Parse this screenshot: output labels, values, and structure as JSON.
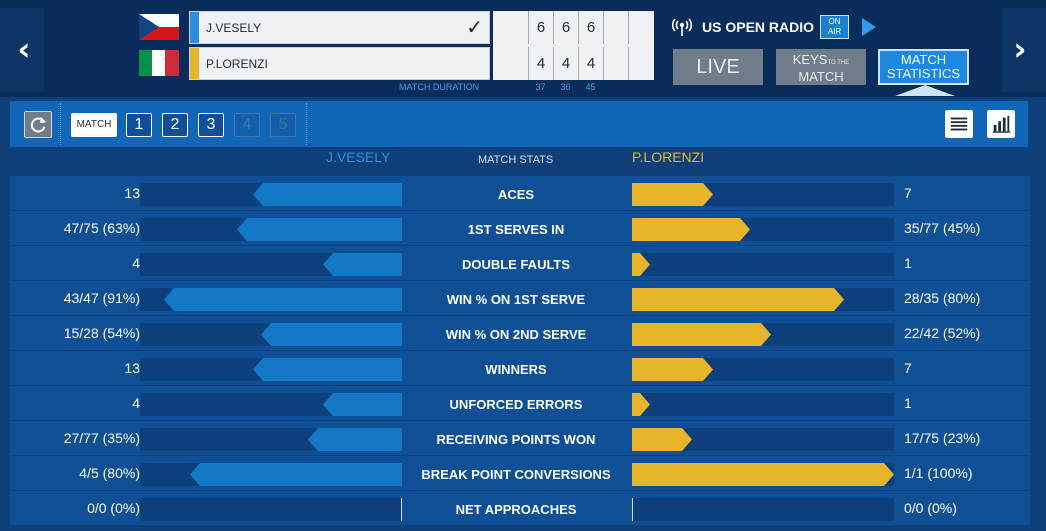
{
  "nav": {
    "prev_icon": "chevron-left-icon",
    "next_icon": "chevron-right-icon",
    "prev_glyph": "‹",
    "next_glyph": "›"
  },
  "match": {
    "player1": {
      "name": "J.VESELY",
      "country": "Czech Republic",
      "sets": [
        "6",
        "6",
        "6",
        "",
        ""
      ],
      "winner_mark": "✓",
      "color": "#2f8ddc"
    },
    "player2": {
      "name": "P.LORENZI",
      "country": "Italy",
      "sets": [
        "4",
        "4",
        "4",
        "",
        ""
      ],
      "color": "#e7b52a"
    },
    "duration_label": "MATCH DURATION",
    "set_durations": [
      "37",
      "36",
      "45"
    ]
  },
  "radio": {
    "label": "US OPEN RADIO",
    "on_air_line1": "ON",
    "on_air_line2": "AIR"
  },
  "tabs": {
    "live": "LIVE",
    "keys_line1": "KEYS",
    "keys_small": "TO THE",
    "keys_line2": "MATCH",
    "stats_line1": "MATCH",
    "stats_line2": "STATISTICS"
  },
  "toolbar": {
    "match_label": "MATCH",
    "sets": [
      {
        "label": "1",
        "enabled": true
      },
      {
        "label": "2",
        "enabled": true
      },
      {
        "label": "3",
        "enabled": true
      },
      {
        "label": "4",
        "enabled": false
      },
      {
        "label": "5",
        "enabled": false
      }
    ]
  },
  "stats_header": {
    "p1": "J.VESELY",
    "title": "MATCH STATS",
    "p2": "P.LORENZI"
  },
  "stats": [
    {
      "label": "ACES",
      "p1": "13",
      "p2": "7",
      "p1_frac": 0.57,
      "p2_frac": 0.31
    },
    {
      "label": "1ST SERVES IN",
      "p1": "47/75 (63%)",
      "p2": "35/77 (45%)",
      "p1_frac": 0.63,
      "p2_frac": 0.45
    },
    {
      "label": "DOUBLE FAULTS",
      "p1": "4",
      "p2": "1",
      "p1_frac": 0.3,
      "p2_frac": 0.04
    },
    {
      "label": "WIN % ON 1ST SERVE",
      "p1": "43/47 (91%)",
      "p2": "28/35 (80%)",
      "p1_frac": 0.91,
      "p2_frac": 0.81
    },
    {
      "label": "WIN % ON 2ND SERVE",
      "p1": "15/28 (54%)",
      "p2": "22/42 (52%)",
      "p1_frac": 0.54,
      "p2_frac": 0.53
    },
    {
      "label": "WINNERS",
      "p1": "13",
      "p2": "7",
      "p1_frac": 0.57,
      "p2_frac": 0.31
    },
    {
      "label": "UNFORCED ERRORS",
      "p1": "4",
      "p2": "1",
      "p1_frac": 0.3,
      "p2_frac": 0.04
    },
    {
      "label": "RECEIVING POINTS WON",
      "p1": "27/77 (35%)",
      "p2": "17/75 (23%)",
      "p1_frac": 0.36,
      "p2_frac": 0.23
    },
    {
      "label": "BREAK POINT CONVERSIONS",
      "p1": "4/5 (80%)",
      "p2": "1/1 (100%)",
      "p1_frac": 0.81,
      "p2_frac": 1.0
    },
    {
      "label": "NET APPROACHES",
      "p1": "0/0 (0%)",
      "p2": "0/0 (0%)",
      "p1_frac": 0.0,
      "p2_frac": 0.0
    }
  ]
}
